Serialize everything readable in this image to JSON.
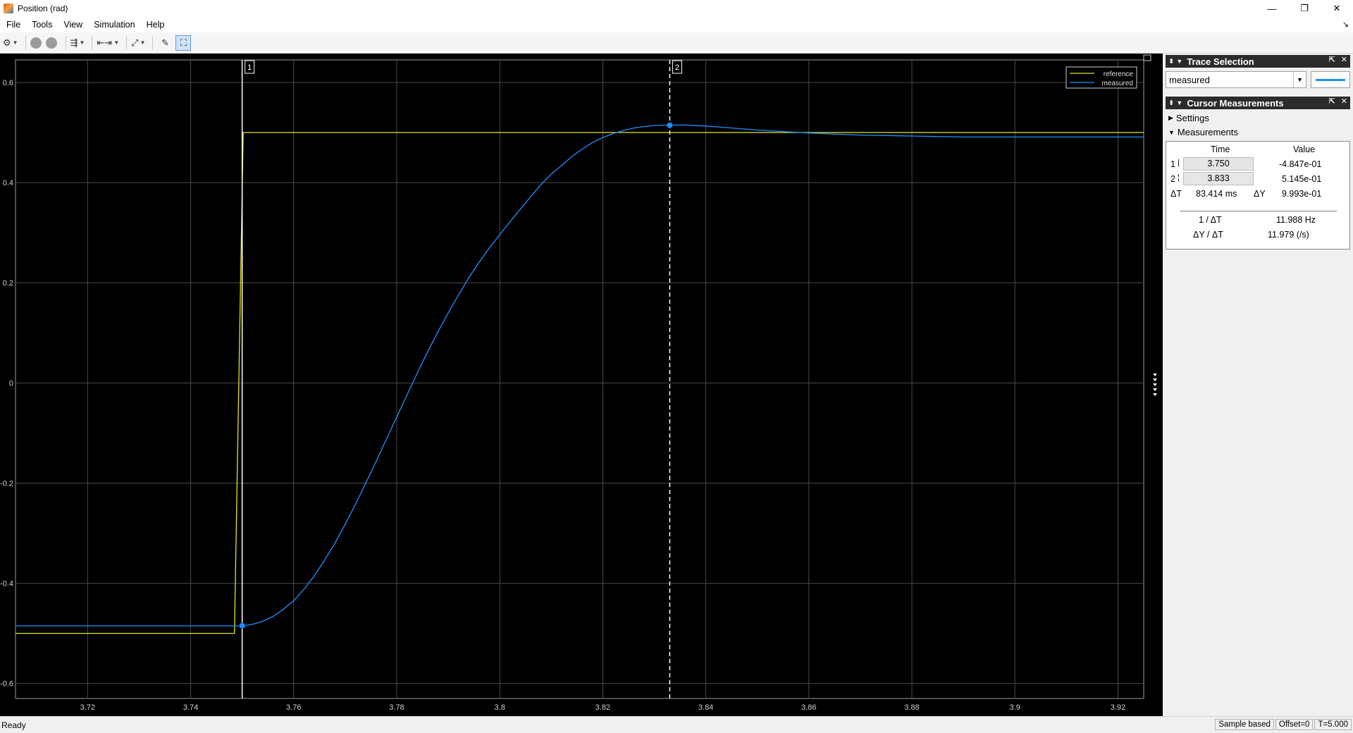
{
  "window": {
    "title": "Position (rad)",
    "minimize": "—",
    "restore": "❐",
    "close": "✕"
  },
  "menu": [
    {
      "label": "File"
    },
    {
      "label": "Tools"
    },
    {
      "label": "View"
    },
    {
      "label": "Simulation"
    },
    {
      "label": "Help"
    }
  ],
  "toolbar": {
    "settings_icon": "⚙",
    "run_icon": "run",
    "stop_icon": "stop",
    "triggers_icon": "⇶",
    "cursor_icon": "⇤⇥",
    "scale_icon": "⤢",
    "highlight_icon": "✎",
    "measure_icon": "⛶"
  },
  "trace_selection": {
    "title": "Trace Selection",
    "selected": "measured",
    "swatch_color": "#1e90ff"
  },
  "cursor_measurements": {
    "title": "Cursor Measurements",
    "settings_label": "Settings",
    "measurements_label": "Measurements",
    "header_time": "Time",
    "header_value": "Value",
    "rows": [
      {
        "id": "1",
        "time": "3.750",
        "value": "-4.847e-01"
      },
      {
        "id": "2",
        "time": "3.833",
        "value": "5.145e-01"
      }
    ],
    "dt_label": "ΔT",
    "dt_value": "83.414 ms",
    "dy_label": "ΔY",
    "dy_value": "9.993e-01",
    "inv_dt_label": "1 / ΔT",
    "inv_dt_value": "11.988 Hz",
    "slope_label": "ΔY / ΔT",
    "slope_value": "11.979 (/s)"
  },
  "chart_data": {
    "type": "line",
    "title": "",
    "xlabel": "",
    "ylabel": "",
    "xlim": [
      3.706,
      3.925
    ],
    "ylim": [
      -0.63,
      0.645
    ],
    "x_ticks": [
      3.72,
      3.74,
      3.76,
      3.78,
      3.8,
      3.82,
      3.84,
      3.86,
      3.88,
      3.9,
      3.92
    ],
    "x_tick_labels": [
      "3.72",
      "3.74",
      "3.76",
      "3.78",
      "3.8",
      "3.82",
      "3.84",
      "3.86",
      "3.88",
      "3.9",
      "3.92"
    ],
    "y_ticks": [
      0.6,
      0.4,
      0.2,
      0,
      -0.2,
      -0.4,
      -0.6
    ],
    "y_tick_labels": [
      "0.6",
      "0.4",
      "0.2",
      "0",
      "-0.2",
      "-0.4",
      "-0.6"
    ],
    "grid": true,
    "legend_position": "top-right",
    "background": "#000000",
    "series": [
      {
        "name": "reference",
        "color": "#e6e619",
        "x": [
          3.706,
          3.7485,
          3.7502,
          3.925
        ],
        "y": [
          -0.5,
          -0.5,
          0.5,
          0.5
        ]
      },
      {
        "name": "measured",
        "color": "#1e90ff",
        "x": [
          3.706,
          3.745,
          3.75,
          3.752,
          3.754,
          3.756,
          3.758,
          3.76,
          3.762,
          3.764,
          3.766,
          3.768,
          3.77,
          3.772,
          3.774,
          3.776,
          3.778,
          3.78,
          3.782,
          3.784,
          3.786,
          3.788,
          3.79,
          3.792,
          3.794,
          3.796,
          3.798,
          3.8,
          3.802,
          3.804,
          3.806,
          3.808,
          3.81,
          3.812,
          3.814,
          3.816,
          3.818,
          3.82,
          3.822,
          3.824,
          3.826,
          3.828,
          3.83,
          3.833,
          3.836,
          3.84,
          3.845,
          3.85,
          3.855,
          3.86,
          3.865,
          3.87,
          3.875,
          3.88,
          3.885,
          3.89,
          3.9,
          3.91,
          3.925
        ],
        "y": [
          -0.485,
          -0.485,
          -0.485,
          -0.482,
          -0.476,
          -0.466,
          -0.452,
          -0.435,
          -0.412,
          -0.385,
          -0.354,
          -0.32,
          -0.282,
          -0.242,
          -0.2,
          -0.157,
          -0.112,
          -0.068,
          -0.024,
          0.02,
          0.062,
          0.102,
          0.14,
          0.176,
          0.21,
          0.241,
          0.27,
          0.296,
          0.322,
          0.347,
          0.372,
          0.396,
          0.417,
          0.434,
          0.452,
          0.467,
          0.48,
          0.49,
          0.498,
          0.504,
          0.509,
          0.512,
          0.514,
          0.515,
          0.515,
          0.513,
          0.509,
          0.505,
          0.502,
          0.499,
          0.497,
          0.495,
          0.494,
          0.493,
          0.492,
          0.491,
          0.491,
          0.491,
          0.491
        ]
      }
    ],
    "cursors": [
      {
        "label": "1",
        "x": 3.75,
        "y": -0.4847,
        "style": "solid"
      },
      {
        "label": "2",
        "x": 3.833,
        "y": 0.5145,
        "style": "dashed"
      }
    ]
  },
  "status": {
    "text": "Ready",
    "sample_mode": "Sample based",
    "offset": "Offset=0",
    "time": "T=5.000"
  }
}
